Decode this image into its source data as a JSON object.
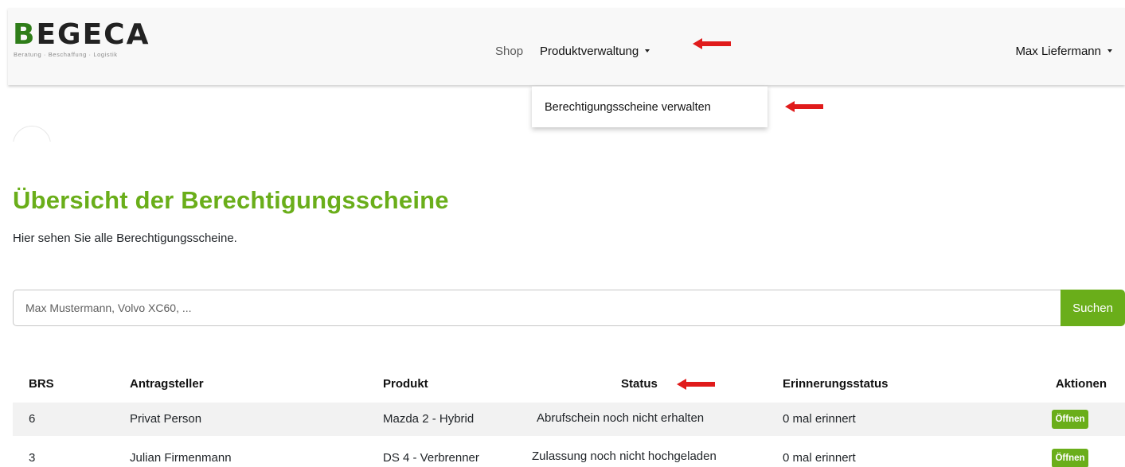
{
  "brand": {
    "name": "EGECA",
    "first_letter": "B",
    "tagline": "Beratung · Beschaffung · Logistik"
  },
  "nav": {
    "shop": "Shop",
    "produktverwaltung": "Produktverwaltung",
    "user": "Max Liefermann",
    "dropdown_items": [
      {
        "label": "Berechtigungsscheine verwalten"
      }
    ]
  },
  "page": {
    "title": "Übersicht der Berechtigungsscheine",
    "subtitle": "Hier sehen Sie alle Berechtigungsscheine."
  },
  "search": {
    "placeholder": "Max Mustermann, Volvo XC60, ...",
    "button": "Suchen"
  },
  "table": {
    "headers": [
      "BRS",
      "Antragsteller",
      "Produkt",
      "Status",
      "Erinnerungsstatus",
      "Aktionen"
    ],
    "rows": [
      {
        "brs": "6",
        "antragsteller": "Privat Person",
        "produkt": "Mazda 2 - Hybrid",
        "status": "Abrufschein noch nicht erhalten",
        "erinnerung": "0 mal erinnert",
        "action": "Öffnen"
      },
      {
        "brs": "3",
        "antragsteller": "Julian Firmenmann",
        "produkt": "DS 4 - Verbrenner",
        "status": "Zulassung noch nicht hochgeladen",
        "erinnerung": "0 mal erinnert",
        "action": "Öffnen"
      }
    ]
  },
  "colors": {
    "accent": "#6aae1a",
    "annotation_arrow": "#e01b1b"
  }
}
